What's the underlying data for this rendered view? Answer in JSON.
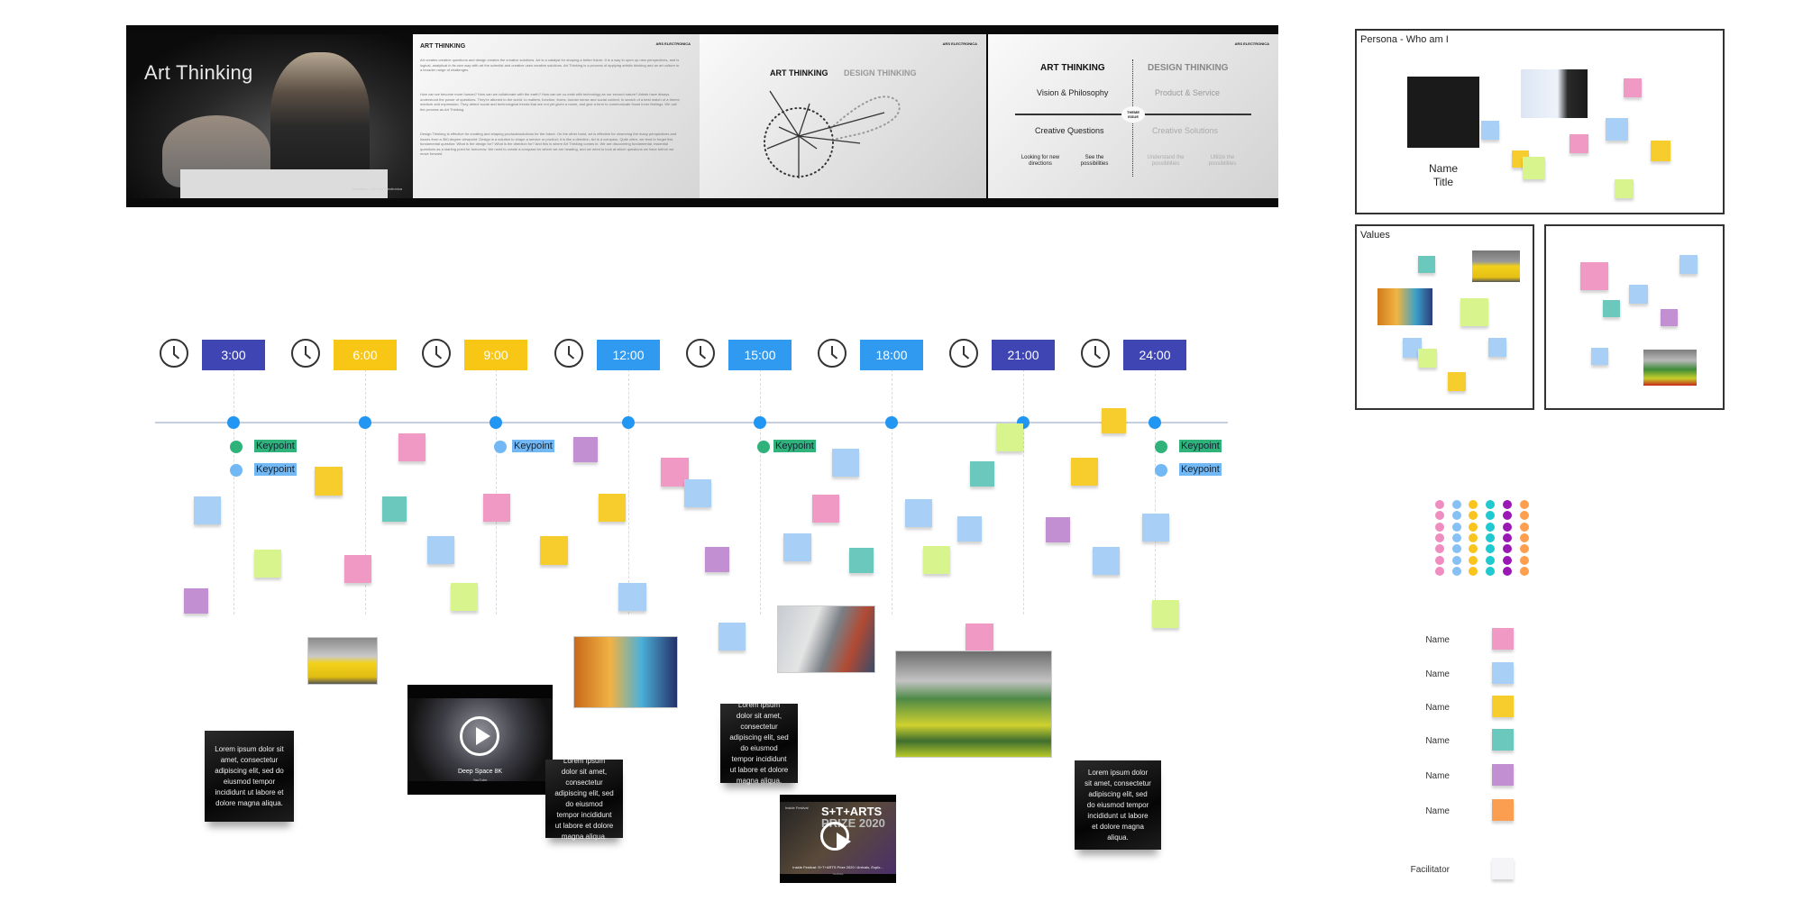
{
  "slides": {
    "slide1": {
      "title": "Art Thinking",
      "caption": "Hackathon, Linz Ars Electronica"
    },
    "slide2": {
      "heading": "ART THINKING",
      "paragraphs": [
        "Art creates creative questions and design creates the creative solutions. Art is a catalyst for shaping a better future. It is a way to open up new perspectives, and is logical, analytical in its own way with art the scientist and creative uses creative solutions. Art Thinking is a process of applying artistic thinking and an art culture to a broader range of challenges.",
        "How can we become more human? How can we collaborate with the earth? How can we co-exist with technology as our second nature? Artists have always understood the power of questions. They're attuned to the world, to matters, function, forms, human sense and social context, in search of a best match of a theme, medium and expression. They detect social and technological trends that are not yet given a name, and give a form to communicate those inner feelings. We call the process as Art Thinking.",
        "Design Thinking is effective for creating and shaping products/solutions for the future. On the other hand, art is effective for observing the many perspectives and issues from a 360-degree viewpoint. Design is a solution to shape a service or product; it is like a direction. Art is a compass. Quite often, we tend to forget this fundamental question: What is the design for? What is the direction for? And this is where Art Thinking comes in. We are discovering fundamental, essential questions as a starting point for tomorrow. We need to create a compass for where we are heading, and we need to look at which questions we have before we move forward."
      ]
    },
    "slide3": {
      "left_title": "ART THINKING",
      "right_title": "DESIGN THINKING"
    },
    "slide4": {
      "left_title": "ART THINKING",
      "right_title": "DESIGN THINKING",
      "left_sub": "Vision & Philosophy",
      "right_sub": "Product & Service",
      "center": "THEME ISSUE",
      "left_lower": "Creative Questions",
      "right_lower": "Creative Solutions",
      "ll1": "Looking for new directions",
      "ll2": "See the possibilities",
      "rl1": "Understand the possibilities",
      "rl2": "Utilize the possibilities"
    },
    "logo": "ARS ELECTRONICA"
  },
  "persona": {
    "label": "Persona - Who am I",
    "name": "Name",
    "title": "Title"
  },
  "values": {
    "label": "Values"
  },
  "timeline": {
    "times": [
      {
        "label": "3:00",
        "color": "#3f45b3"
      },
      {
        "label": "6:00",
        "color": "#f8c614"
      },
      {
        "label": "9:00",
        "color": "#f8c614"
      },
      {
        "label": "12:00",
        "color": "#2f9af0"
      },
      {
        "label": "15:00",
        "color": "#2f9af0"
      },
      {
        "label": "18:00",
        "color": "#2f9af0"
      },
      {
        "label": "21:00",
        "color": "#3f45b3"
      },
      {
        "label": "24:00",
        "color": "#3f45b3"
      }
    ],
    "keypoint_label": "Keypoint"
  },
  "notes": {
    "lorem": "Lorem ipsum dolor sit amet, consectetur adipiscing elit, sed do eiusmod tempor incididunt ut labore et dolore magna aliqua."
  },
  "videos": {
    "deep_space": {
      "title": "Deep Space 8K",
      "source": "YouTube"
    },
    "starts": {
      "badge": "Inside Festival",
      "heading1": "S+T+ARTS",
      "heading2": "PRIZE 2020",
      "title": "Inside Festival: S+T+ARTS Prize 2020 / Arrivals, Explo...",
      "source": "YouTube"
    }
  },
  "legend": {
    "entries": [
      {
        "name": "Name",
        "color": "#ef99c4"
      },
      {
        "name": "Name",
        "color": "#a8cff5"
      },
      {
        "name": "Name",
        "color": "#f6cd2c"
      },
      {
        "name": "Name",
        "color": "#6ac8bc"
      },
      {
        "name": "Name",
        "color": "#c28fd2"
      },
      {
        "name": "Name",
        "color": "#fc9e4f"
      }
    ],
    "facilitator": {
      "name": "Facilitator",
      "color": "#f5f5f8"
    },
    "palette": [
      "#ef8cc0",
      "#86c0f5",
      "#f9c41d",
      "#1fc9cf",
      "#9a19b5",
      "#fd9f4e"
    ]
  }
}
